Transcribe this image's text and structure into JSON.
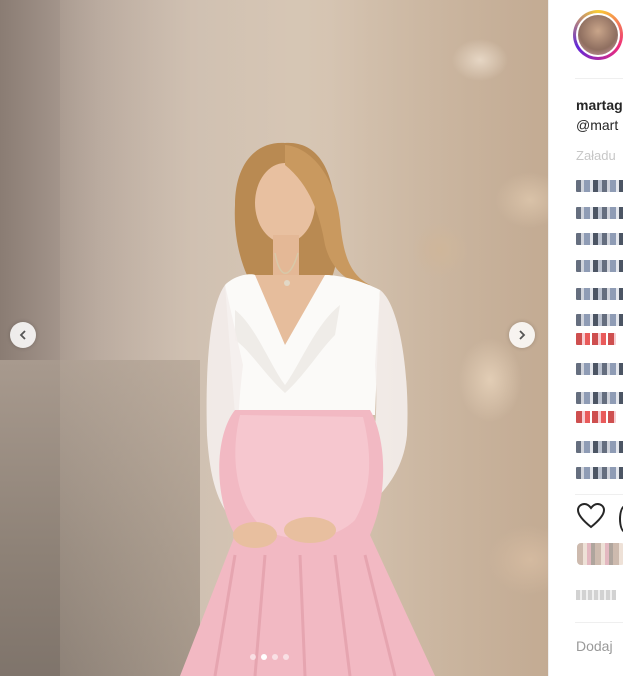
{
  "post": {
    "carousel": {
      "slide_count": 4,
      "active_slide": 2
    }
  },
  "sidebar": {
    "username": "martag",
    "handle": "@mart",
    "loading_text": "Załadu",
    "add_comment": "Dodaj"
  },
  "icons": {
    "prev": "chevron-left-icon",
    "next": "chevron-right-icon",
    "like": "heart-icon",
    "comment": "comment-icon"
  },
  "colors": {
    "dress_pink": "#f2b9c3",
    "top_white": "#ffffff",
    "text_dark": "#262626",
    "text_muted": "#c7c7c7"
  }
}
